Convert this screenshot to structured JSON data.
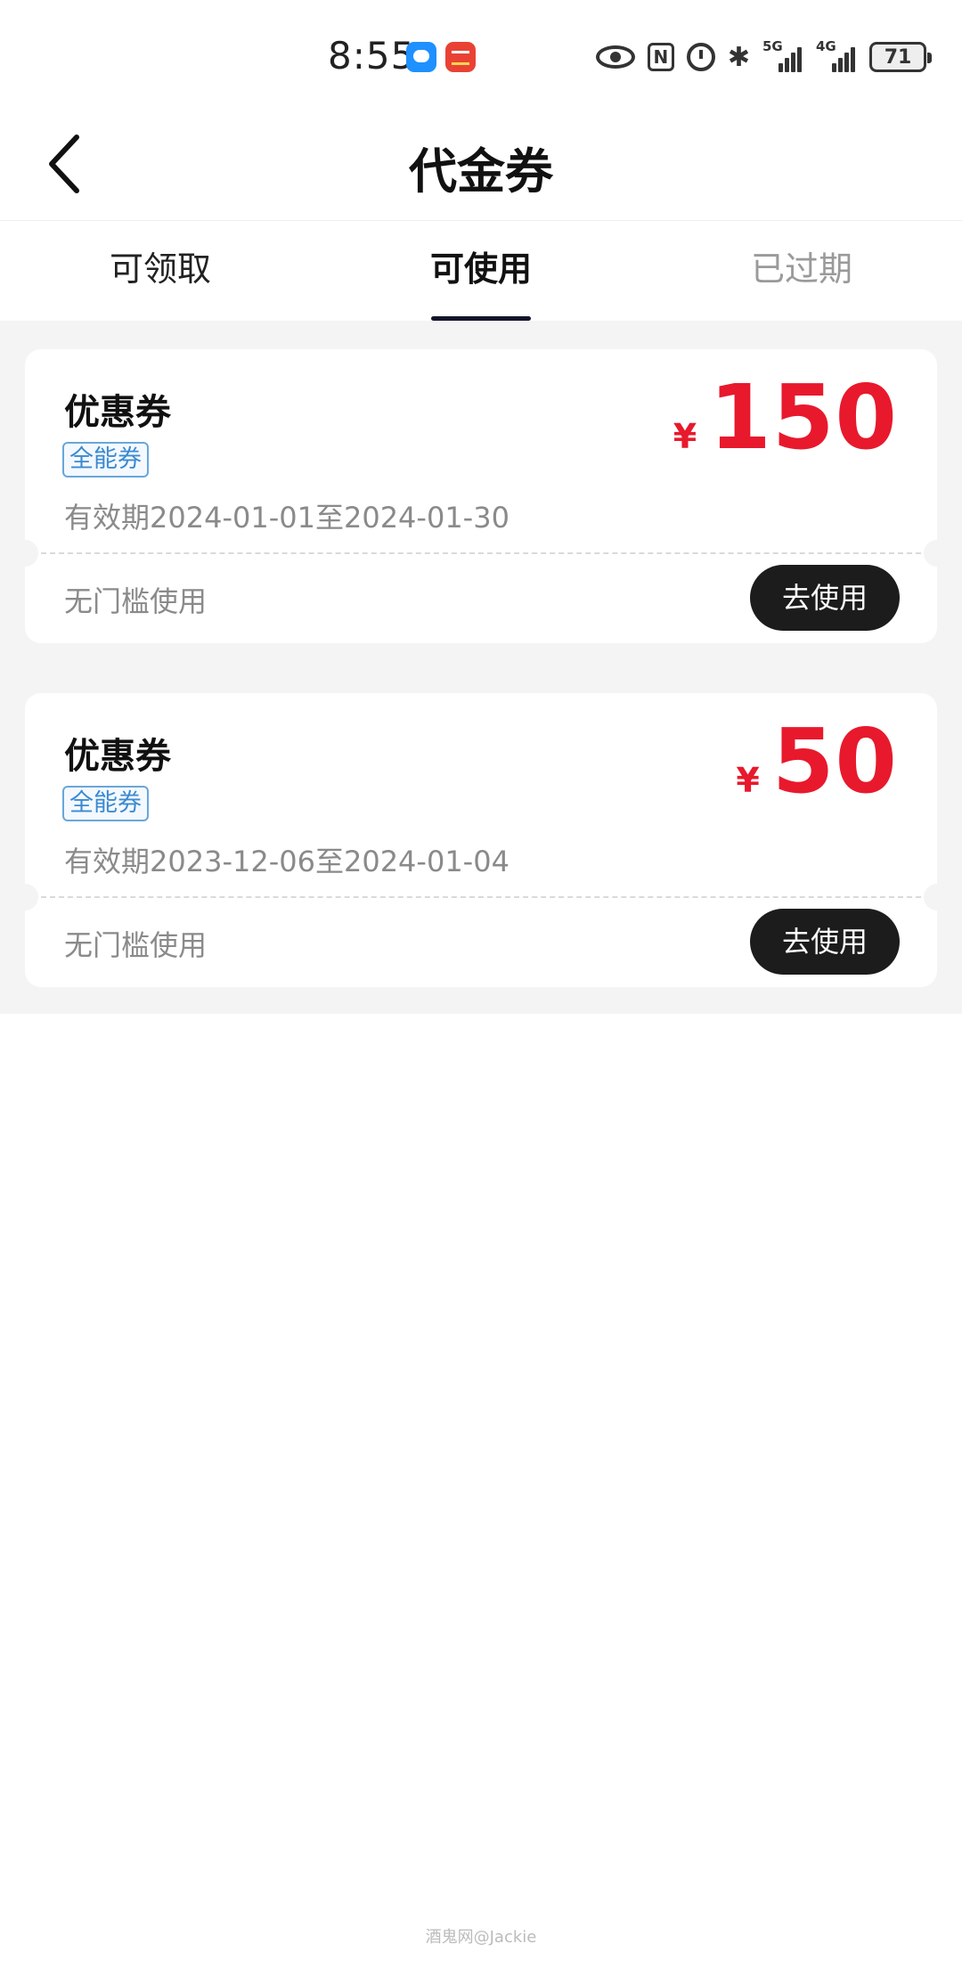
{
  "status_bar": {
    "time": "8:55",
    "signal_1_label": "5G",
    "signal_2_label": "4G",
    "battery_level": "71",
    "nfc_label": "N",
    "bluetooth_glyph": "✱",
    "icons": [
      "message-app-icon",
      "red-app-icon",
      "eye-icon",
      "nfc-icon",
      "alarm-icon",
      "bluetooth-icon",
      "signal-5g-icon",
      "signal-4g-icon",
      "battery-icon"
    ]
  },
  "header": {
    "title": "代金券",
    "back_icon": "chevron-left-icon"
  },
  "tabs": [
    {
      "label": "可领取",
      "active": false
    },
    {
      "label": "可使用",
      "active": true
    },
    {
      "label": "已过期",
      "active": false
    }
  ],
  "coupons": [
    {
      "title": "优惠券",
      "tag": "全能券",
      "validity": "有效期2024-01-01至2024-01-30",
      "currency": "¥",
      "amount": "150",
      "condition": "无门槛使用",
      "action": "去使用"
    },
    {
      "title": "优惠券",
      "tag": "全能券",
      "validity": "有效期2023-12-06至2024-01-04",
      "currency": "¥",
      "amount": "50",
      "condition": "无门槛使用",
      "action": "去使用"
    }
  ],
  "watermark": "酒鬼网@Jackie",
  "colors": {
    "accent_red": "#e8192c",
    "tab_underline": "#14142b",
    "button_bg": "#1c1c1c",
    "tag_blue": "#3b8ad0",
    "list_bg": "#f4f4f4"
  }
}
